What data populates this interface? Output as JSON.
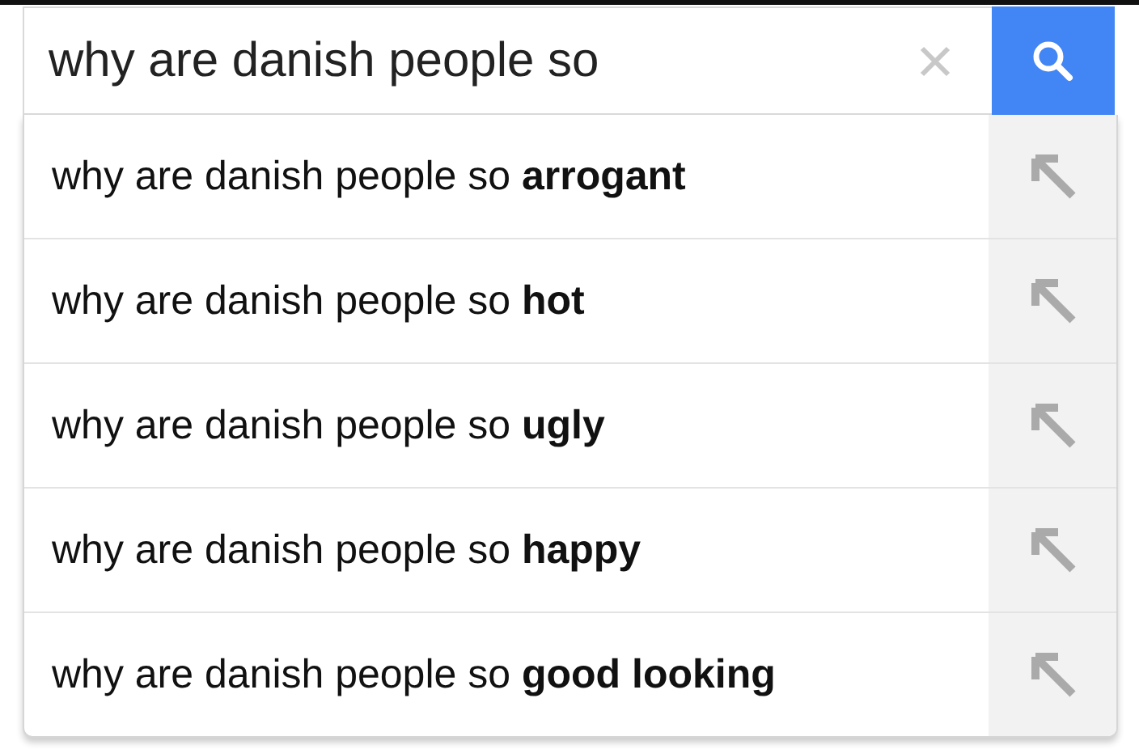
{
  "search": {
    "value": "why are danish people so"
  },
  "suggestions": [
    {
      "text": "why are danish people so **arrogant**"
    },
    {
      "text": "why are danish people so **hot**"
    },
    {
      "text": "why are danish people so **ugly**"
    },
    {
      "text": "why are danish people so **happy**"
    },
    {
      "text": "why are danish people so **good looking**"
    }
  ]
}
